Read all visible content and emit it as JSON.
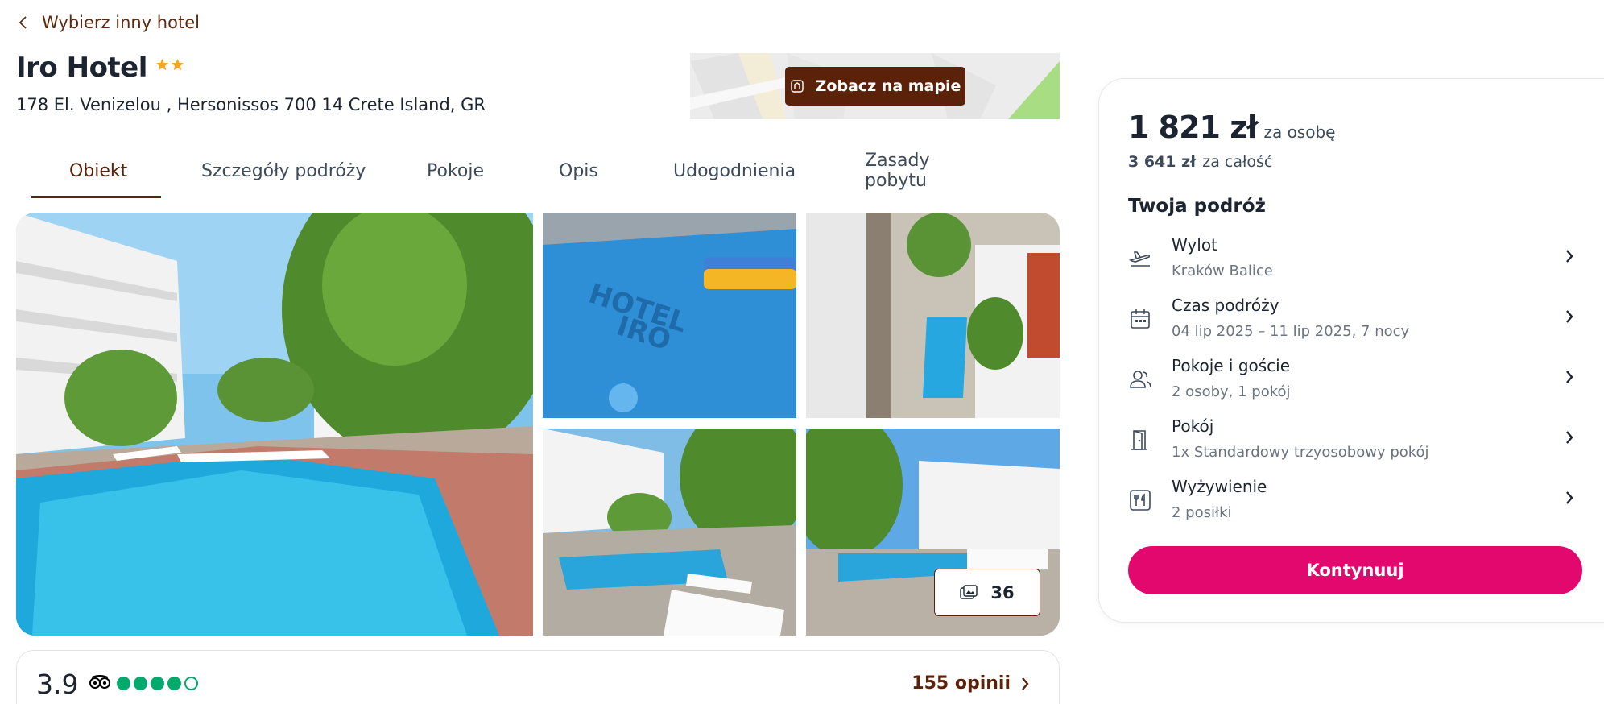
{
  "nav": {
    "back_label": "Wybierz inny hotel"
  },
  "hotel": {
    "name": "Iro Hotel",
    "star_count": 2,
    "address": "178 El. Venizelou , Hersonissos 700 14 Crete Island, GR"
  },
  "map": {
    "button_label": "Zobacz na mapie"
  },
  "tabs": [
    {
      "label": "Obiekt",
      "active": true
    },
    {
      "label": "Szczegóły podróży",
      "active": false
    },
    {
      "label": "Pokoje",
      "active": false
    },
    {
      "label": "Opis",
      "active": false
    },
    {
      "label": "Udogodnienia",
      "active": false
    },
    {
      "label": "Zasady pobytu",
      "active": false
    }
  ],
  "gallery": {
    "photo_count": "36"
  },
  "rating": {
    "score": "3.9",
    "bubbles_filled": 4,
    "bubbles_total": 5,
    "reviews_label": "155 opinii"
  },
  "booking": {
    "price_per_person": "1 821 zł",
    "per_person_label": "za osobę",
    "price_total": "3 641 zł",
    "total_label": "za całość",
    "trip_heading": "Twoja podróż",
    "items": [
      {
        "icon": "plane-departure-icon",
        "title": "Wylot",
        "subtitle": "Kraków Balice"
      },
      {
        "icon": "calendar-icon",
        "title": "Czas podróży",
        "subtitle": "04 lip 2025 – 11 lip 2025, 7 nocy"
      },
      {
        "icon": "guests-icon",
        "title": "Pokoje i goście",
        "subtitle": "2 osoby, 1 pokój"
      },
      {
        "icon": "door-icon",
        "title": "Pokój",
        "subtitle": "1x Standardowy trzyosobowy pokój"
      },
      {
        "icon": "meals-icon",
        "title": "Wyżywienie",
        "subtitle": "2 posiłki"
      }
    ],
    "continue_label": "Kontynuuj"
  },
  "colors": {
    "brand_brown": "#5c2109",
    "cta_pink": "#e3086e",
    "star_orange": "#f5a623",
    "tripadvisor_green": "#00aa6c"
  }
}
